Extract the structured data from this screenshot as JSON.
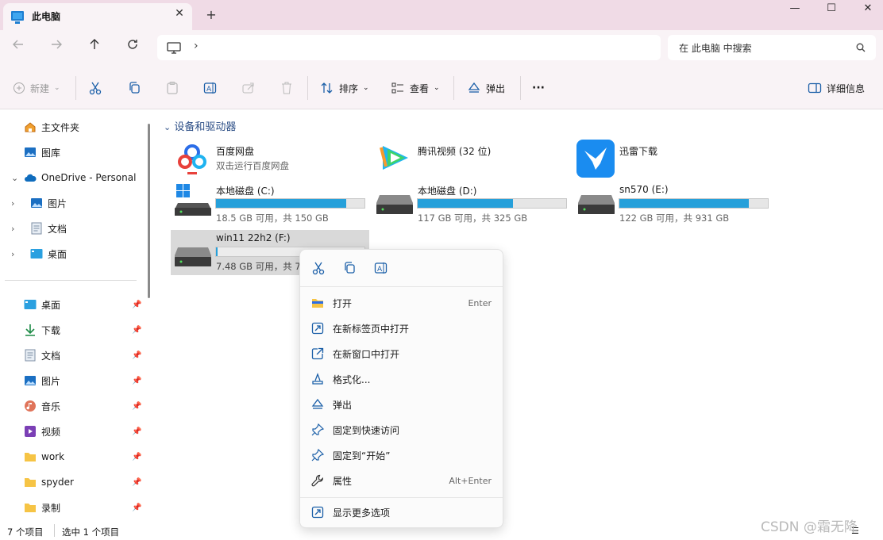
{
  "window": {
    "tab_title": "此电脑",
    "new_tab": "+",
    "close_tab": "✕",
    "minimize": "—",
    "maximize": "☐",
    "close": "✕"
  },
  "address": {
    "chevron": "›",
    "search_placeholder": "在 此电脑 中搜索"
  },
  "toolbar": {
    "new": "新建",
    "sort": "排序",
    "view": "查看",
    "eject": "弹出",
    "more": "···",
    "details": "详细信息"
  },
  "sidebar": {
    "top": [
      {
        "label": "主文件夹"
      },
      {
        "label": "图库"
      },
      {
        "label": "OneDrive - Personal"
      },
      {
        "label": "图片"
      },
      {
        "label": "文档"
      },
      {
        "label": "桌面"
      }
    ],
    "pinned": [
      {
        "label": "桌面"
      },
      {
        "label": "下载"
      },
      {
        "label": "文档"
      },
      {
        "label": "图片"
      },
      {
        "label": "音乐"
      },
      {
        "label": "视频"
      },
      {
        "label": "work"
      },
      {
        "label": "spyder"
      },
      {
        "label": "录制"
      }
    ]
  },
  "main": {
    "section": "设备和驱动器",
    "apps": [
      {
        "name": "百度网盘",
        "sub": "双击运行百度网盘"
      },
      {
        "name": "腾讯视频 (32 位)"
      },
      {
        "name": "迅雷下载"
      }
    ],
    "drives": [
      {
        "name": "本地磁盘 (C:)",
        "sub": "18.5 GB 可用，共 150 GB",
        "used_fraction": 0.877
      },
      {
        "name": "本地磁盘 (D:)",
        "sub": "117 GB 可用，共 325 GB",
        "used_fraction": 0.64
      },
      {
        "name": "sn570 (E:)",
        "sub": "122 GB 可用，共 931 GB",
        "used_fraction": 0.869
      },
      {
        "name": "win11 22h2 (F:)",
        "sub": "7.48 GB 可用，共 7",
        "used_fraction": 0.01
      }
    ]
  },
  "context_menu": {
    "items": [
      {
        "label": "打开",
        "shortcut": "Enter"
      },
      {
        "label": "在新标签页中打开"
      },
      {
        "label": "在新窗口中打开"
      },
      {
        "label": "格式化..."
      },
      {
        "label": "弹出"
      },
      {
        "label": "固定到快速访问"
      },
      {
        "label": "固定到“开始”"
      },
      {
        "label": "属性",
        "shortcut": "Alt+Enter"
      },
      {
        "label": "显示更多选项"
      }
    ]
  },
  "status": {
    "count": "7 个项目",
    "selected": "选中 1 个项目"
  },
  "watermark": "CSDN @霜无降",
  "colors": {
    "accent": "#26a0da",
    "titlebar": "#f0dbe6",
    "toolbar": "#f9f3f6"
  }
}
